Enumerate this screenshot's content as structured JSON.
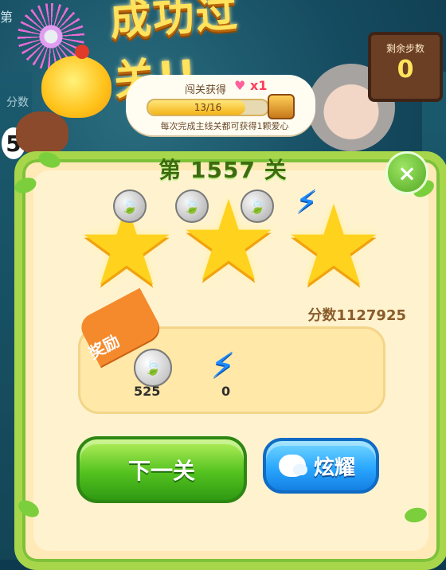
{
  "header": {
    "title": "成功过关!!",
    "steps_sign": {
      "label": "剩余步数",
      "value": "0"
    }
  },
  "left_overlays": {
    "top_char": "第",
    "score_stub": "分数",
    "round_number": "5"
  },
  "reward_bubble": {
    "title": "闯关获得",
    "multiplier": "x1",
    "progress": {
      "current": 13,
      "total": 16,
      "text": "13/16"
    },
    "note": "每次完成主线关都可获得1颗爱心"
  },
  "level": {
    "label": "第 1557 关"
  },
  "stars": {
    "earned": 3,
    "total": 3
  },
  "score": {
    "text": "分数1127925"
  },
  "rewards": {
    "ribbon_label": "奖励",
    "items": [
      {
        "name": "silver-leaf",
        "count": "525"
      },
      {
        "name": "lightning",
        "count": "0"
      }
    ]
  },
  "buttons": {
    "next_label": "下一关",
    "share_label": "炫耀"
  },
  "icons": {
    "close": "close-icon",
    "heart": "heart-icon",
    "chest": "treasure-chest-icon",
    "wechat": "wechat-icon"
  },
  "colors": {
    "panel_border": "#a7d64b",
    "panel_bg": "#fff3cf",
    "star": "#ffd21d",
    "title": "#ffe35c",
    "next_button": "#53c21f",
    "share_button": "#2aa7ff"
  }
}
